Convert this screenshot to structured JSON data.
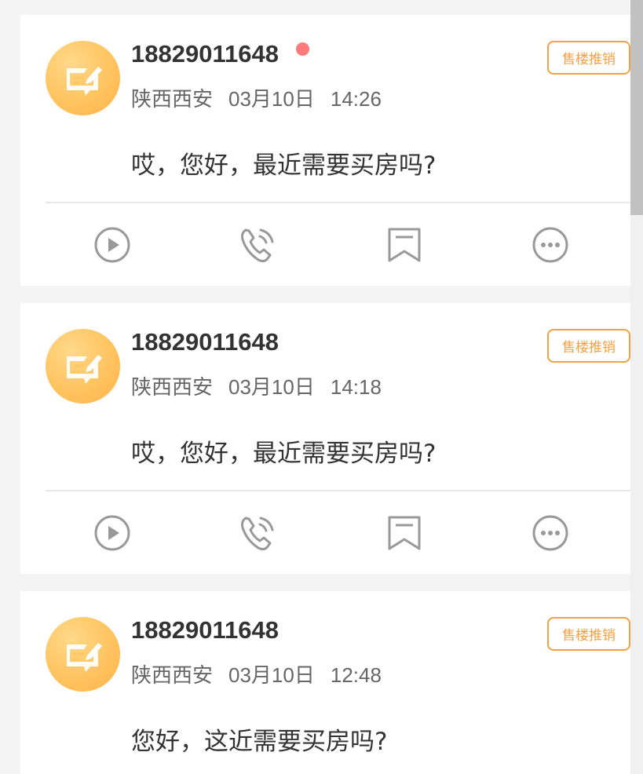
{
  "colors": {
    "page_bg": "#f4f4f4",
    "card_bg": "#ffffff",
    "accent_orange": "#f5a043",
    "unread_dot": "#ff7a7a",
    "avatar_gradient": [
      "#ffd98a",
      "#ffb347"
    ]
  },
  "icons": {
    "avatar": "message-edit-icon",
    "play": "play-circle-icon",
    "call": "phone-call-icon",
    "bookmark": "bookmark-icon",
    "more": "more-dots-icon"
  },
  "records": [
    {
      "phone": "18829011648",
      "unread": true,
      "location": "陕西西安",
      "date": "03月10日",
      "time": "14:26",
      "tag": "售楼推销",
      "message": "哎，您好，最近需要买房吗?"
    },
    {
      "phone": "18829011648",
      "unread": false,
      "location": "陕西西安",
      "date": "03月10日",
      "time": "14:18",
      "tag": "售楼推销",
      "message": "哎，您好，最近需要买房吗?"
    },
    {
      "phone": "18829011648",
      "unread": false,
      "location": "陕西西安",
      "date": "03月10日",
      "time": "12:48",
      "tag": "售楼推销",
      "message": "您好，这近需要买房吗?"
    }
  ]
}
